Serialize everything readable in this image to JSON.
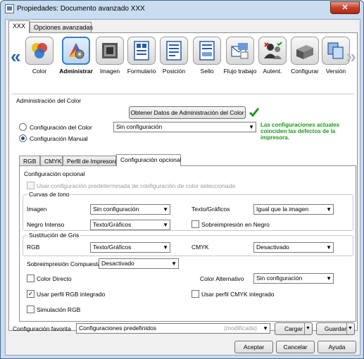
{
  "window": {
    "title": "Propiedades: Documento avanzado XXX",
    "close": "✕"
  },
  "top_tabs": [
    "XXX",
    "Opciones avanzadas"
  ],
  "nav": {
    "left_arrow": "«",
    "right_arrow": "»",
    "items": [
      {
        "label": "Color",
        "icon": "color-balls-icon"
      },
      {
        "label": "Administrar",
        "icon": "color-wheel-gear-icon"
      },
      {
        "label": "Imagen",
        "icon": "image-grid-icon"
      },
      {
        "label": "Formulario",
        "icon": "form-document-icon"
      },
      {
        "label": "Posición",
        "icon": "position-document-icon"
      },
      {
        "label": "Sello",
        "icon": "stamp-document-icon"
      },
      {
        "label": "Flujo trabajo",
        "icon": "workflow-envelope-icon"
      },
      {
        "label": "Autent.",
        "icon": "user-authentication-icon"
      },
      {
        "label": "Configurar",
        "icon": "printer-configure-icon"
      },
      {
        "label": "Versión",
        "icon": "version-windows-icon"
      }
    ]
  },
  "color_admin": {
    "section_title": "Administración del Color",
    "obtain_button": "Obtener Datos de Administración del Color",
    "radio_color_config": "Configuración del Color",
    "radio_manual": "Configuración Manual",
    "config_select": "Sin configuración",
    "status_message": "Las configuraciones actuales coinciden las defectos de la impresora."
  },
  "sub_tabs": [
    "RGB",
    "CMYK",
    "Perfil de Impresora",
    "Configuración opcional"
  ],
  "optional": {
    "title": "Configuración opcional",
    "use_default": "Usar configuración predeterminada de configuración de color seleccionada",
    "tone_curves_title": "Curvas de tono",
    "image_label": "Imagen",
    "image_value": "Sin configuración",
    "text_graphics_label": "Texto/Gráficos",
    "text_graphics_value": "Igual que la imagen",
    "intense_black_label": "Negro Intenso",
    "intense_black_value": "Texto/Gráficos",
    "overprint_black": "Sobreimpresión en Negro",
    "gray_sub_title": "Sustitución de Gris",
    "rgb_label": "RGB",
    "rgb_value": "Texto/Gráficos",
    "cmyk_label": "CMYK",
    "cmyk_value": "Desactivado",
    "composite_label": "Sobreimpresión Compuesta",
    "composite_value": "Desactivado",
    "direct_color": "Color Directo",
    "alt_color_label": "Color Alternativo",
    "alt_color_value": "Sin configuración",
    "use_rgb_profile": "Usar perfil RGB integrado",
    "use_cmyk_profile": "Usar perfil CMYK integrado",
    "rgb_simulation": "Simulación RGB"
  },
  "footer": {
    "fav_label": "Configuración favorita",
    "fav_value": "Configuraciones predefinidos",
    "fav_modified": "(modificada)",
    "load": "Cargar",
    "save": "Guardar",
    "accept": "Aceptar",
    "cancel": "Cancelar",
    "help": "Ayuda"
  }
}
